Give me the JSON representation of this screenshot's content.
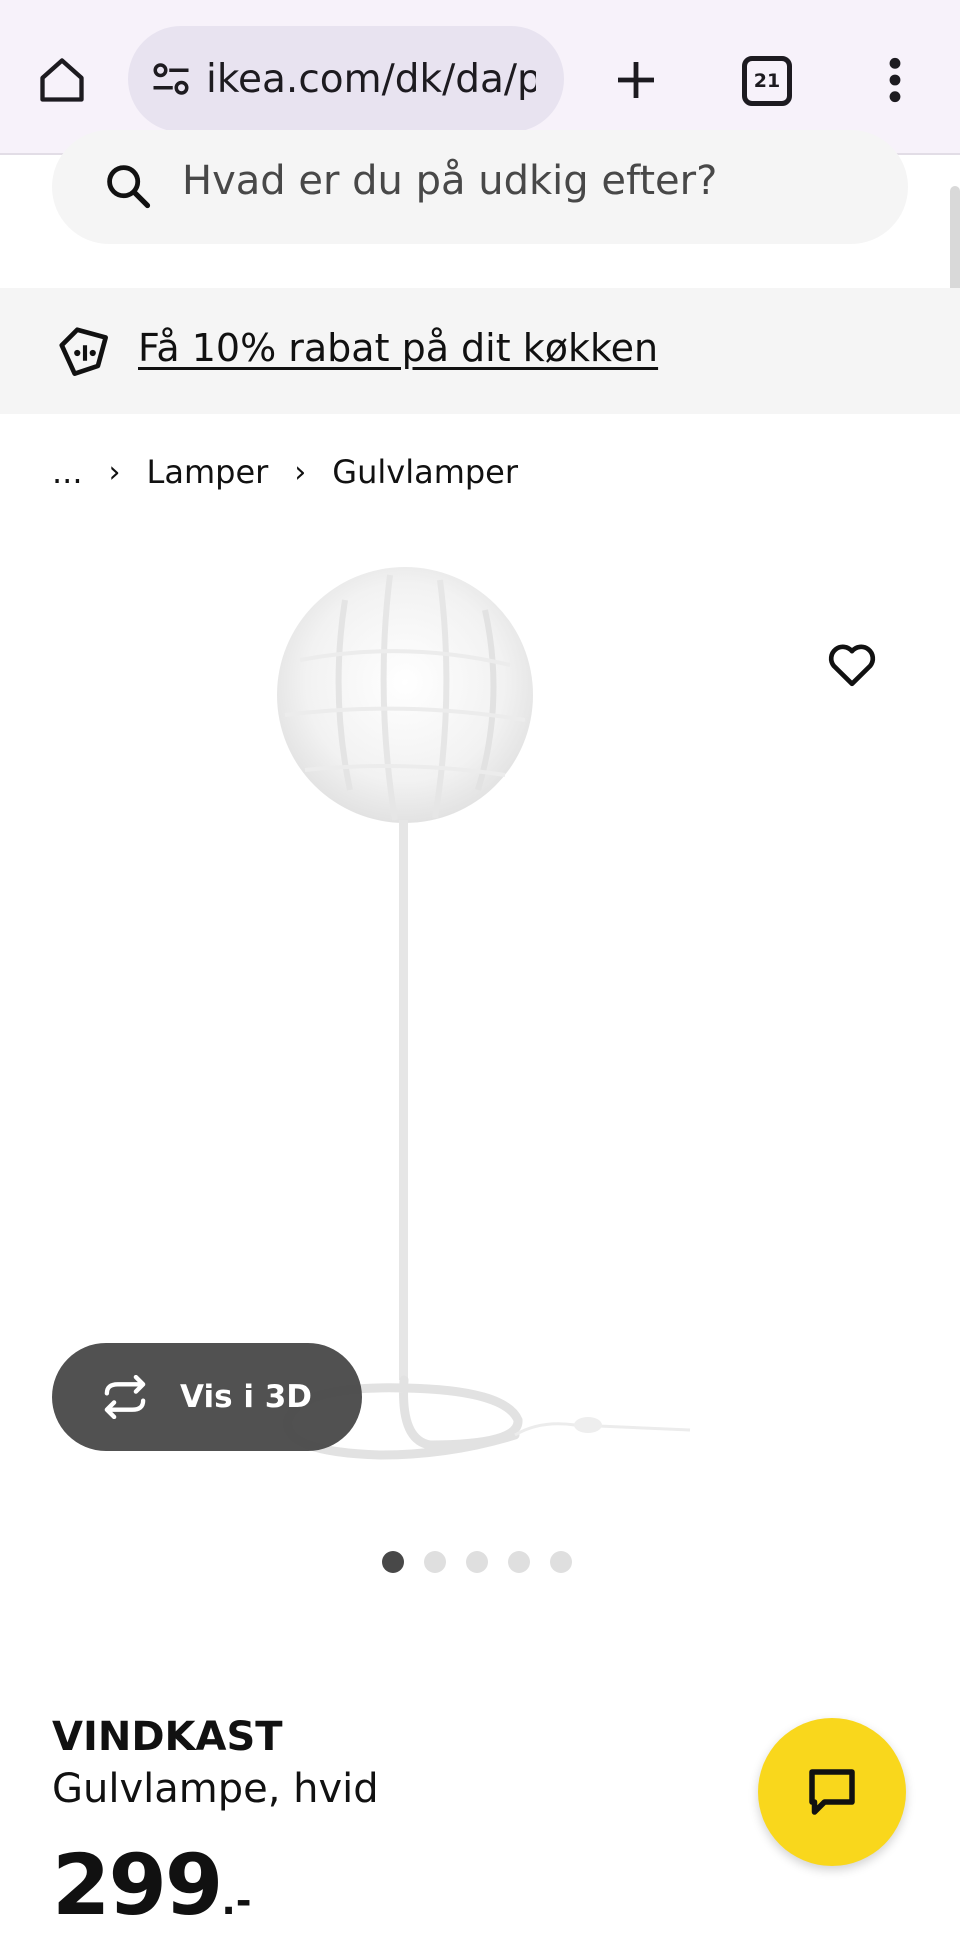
{
  "browser": {
    "url": "ikea.com/dk/da/p/",
    "tab_count": "21"
  },
  "search": {
    "placeholder": "Hvad er du på udkig efter?"
  },
  "promo": {
    "link_text": "Få 10% rabat på dit køkken"
  },
  "breadcrumb": {
    "items": [
      "...",
      "Lamper",
      "Gulvlamper"
    ]
  },
  "gallery": {
    "view_3d_label": "Vis i 3D",
    "total_images": 5,
    "active_index": 0
  },
  "product": {
    "name": "VINDKAST",
    "description": "Gulvlampe, hvid",
    "price": "299",
    "price_suffix": ".-"
  },
  "colors": {
    "chrome_bg": "#f7f2fa",
    "urlbar_bg": "#e8e3f0",
    "promo_bg": "#f5f5f5",
    "chat_button": "#f9d71c",
    "view3d_button": "#484848"
  },
  "icons": {
    "home": "home-icon",
    "site_settings": "tune-icon",
    "new_tab": "plus-icon",
    "menu": "more-vert-icon",
    "search": "search-icon",
    "promo": "price-tag-icon",
    "favorite": "heart-icon",
    "rotate3d": "rotate-3d-icon",
    "chat": "chat-icon"
  }
}
